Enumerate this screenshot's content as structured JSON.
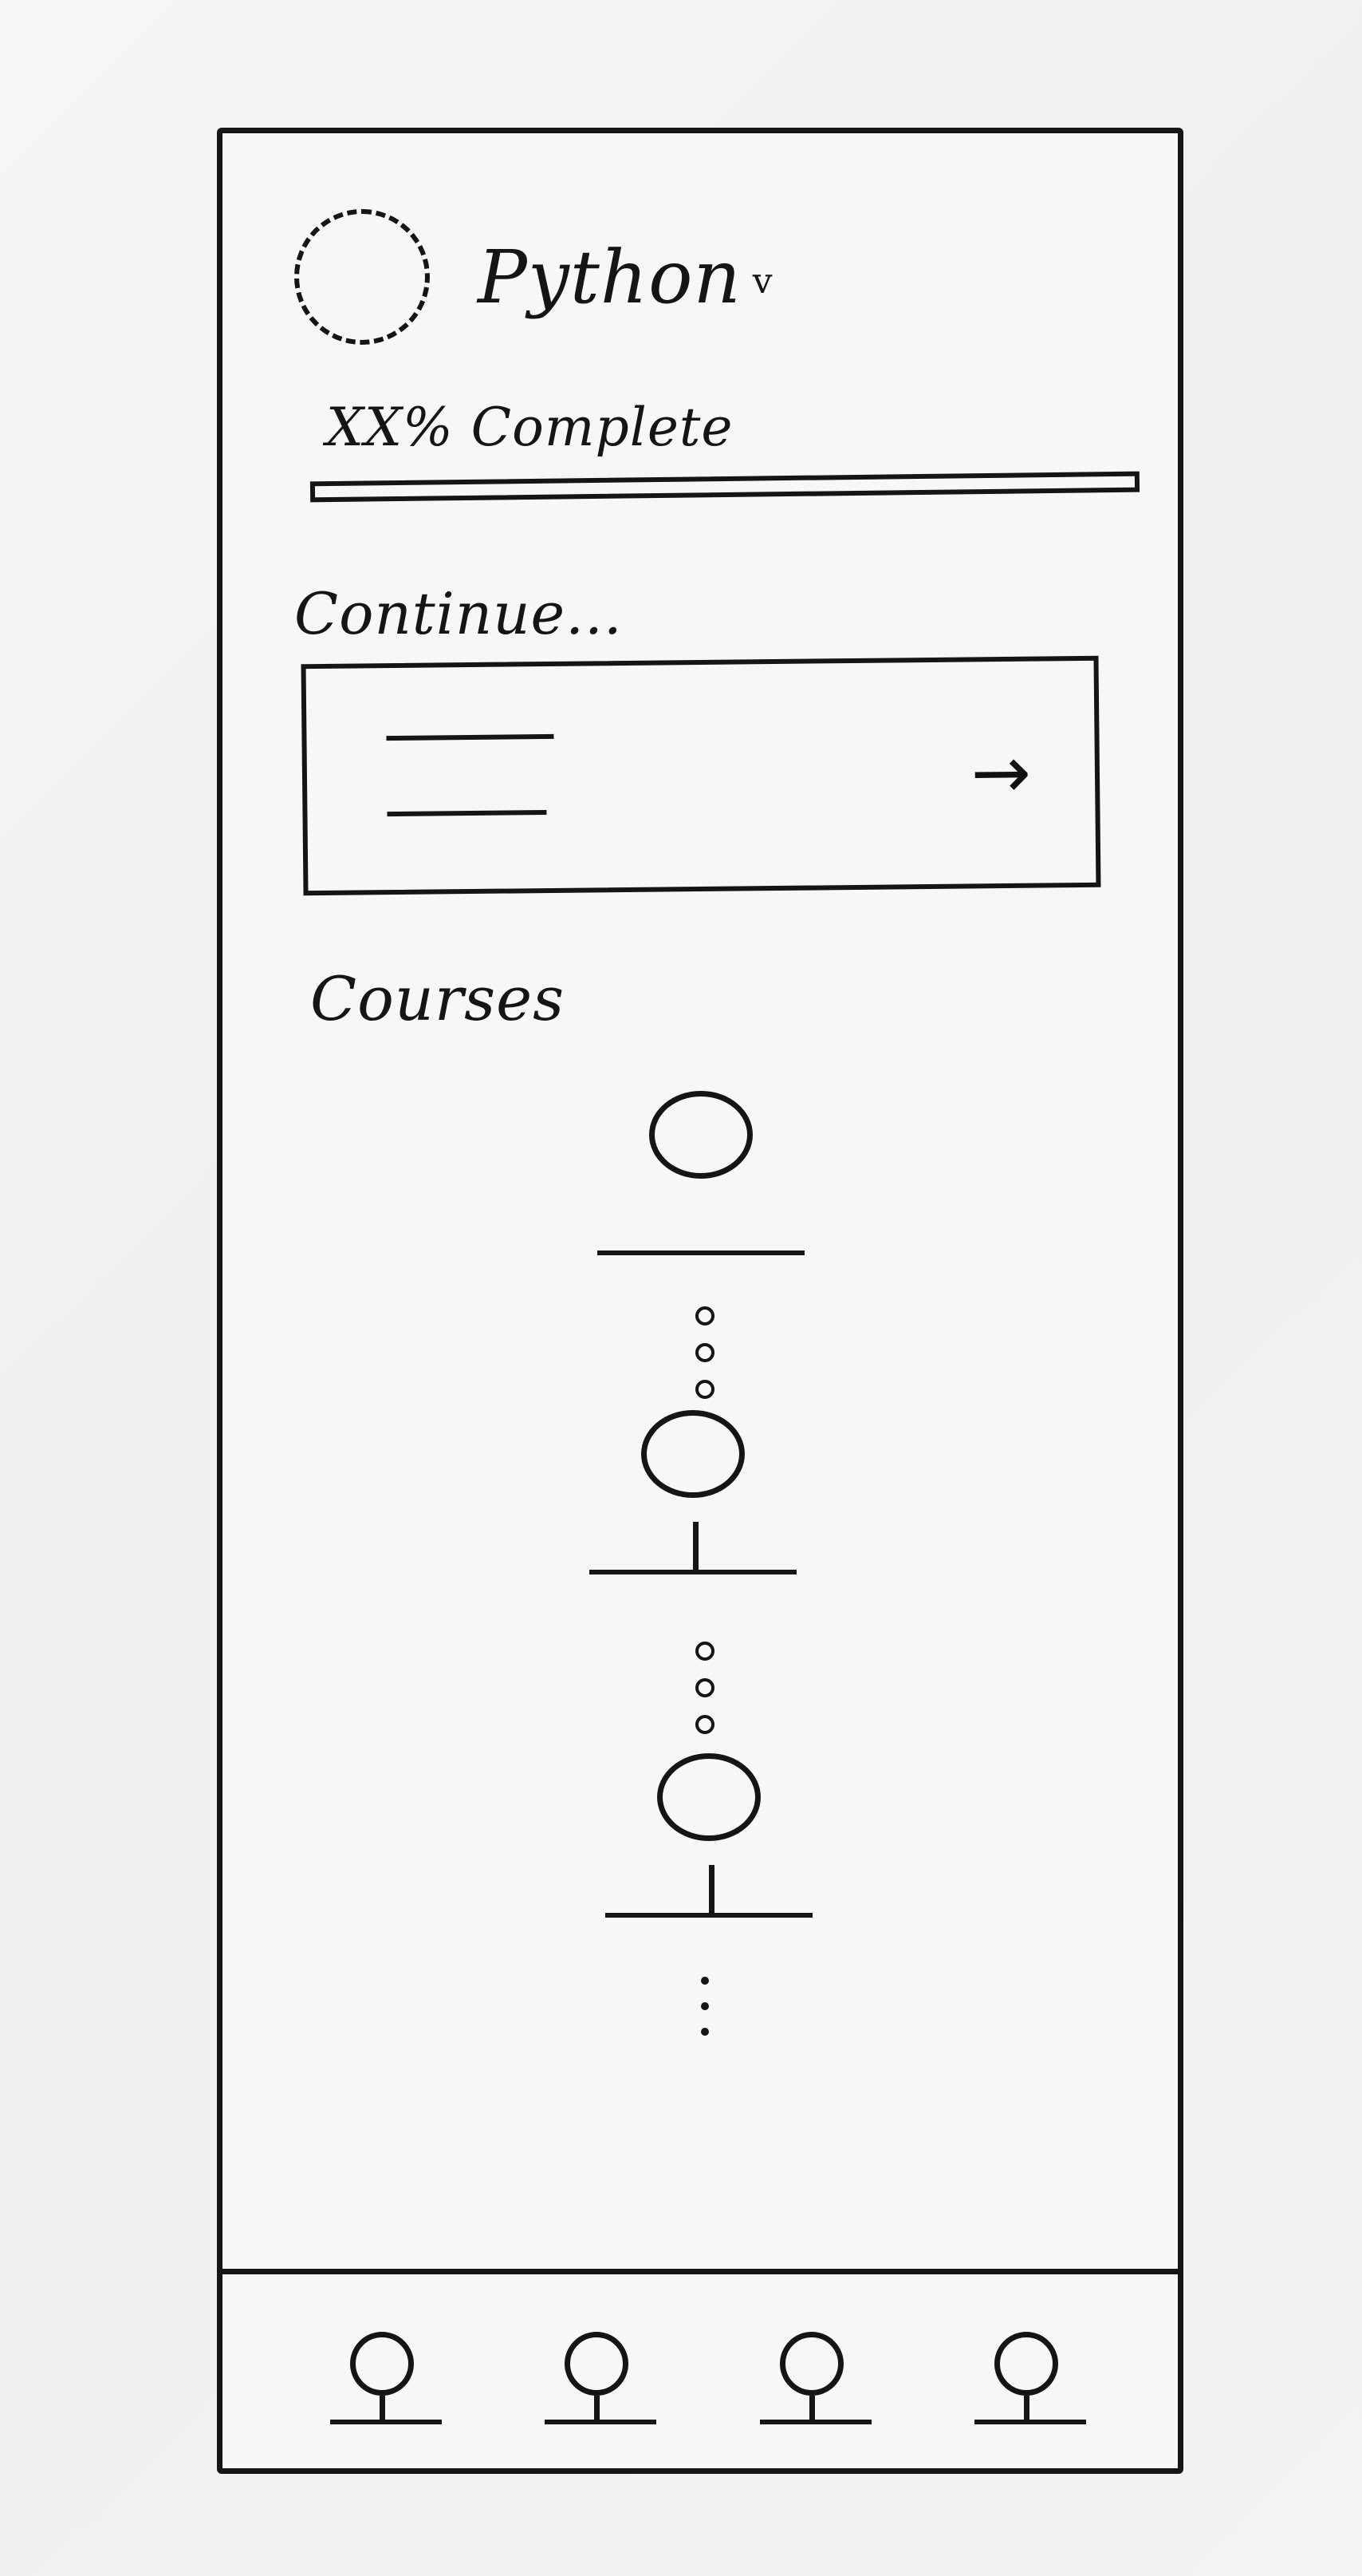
{
  "course": {
    "name": "Python",
    "logo_icon": "course-logo-placeholder-icon",
    "selector_icon": "chevron-down-icon"
  },
  "progress": {
    "label": "XX% Complete"
  },
  "continue": {
    "heading": "Continue...",
    "card_icon": "arrow-right-icon"
  },
  "courses": {
    "heading": "Courses",
    "nodes": [
      {
        "icon": "course-node-icon"
      },
      {
        "icon": "course-node-icon"
      },
      {
        "icon": "course-node-icon"
      }
    ]
  },
  "bottom_nav": {
    "items": [
      {
        "icon": "nav-tab-icon"
      },
      {
        "icon": "nav-tab-icon"
      },
      {
        "icon": "nav-tab-icon"
      },
      {
        "icon": "nav-tab-icon"
      }
    ]
  }
}
